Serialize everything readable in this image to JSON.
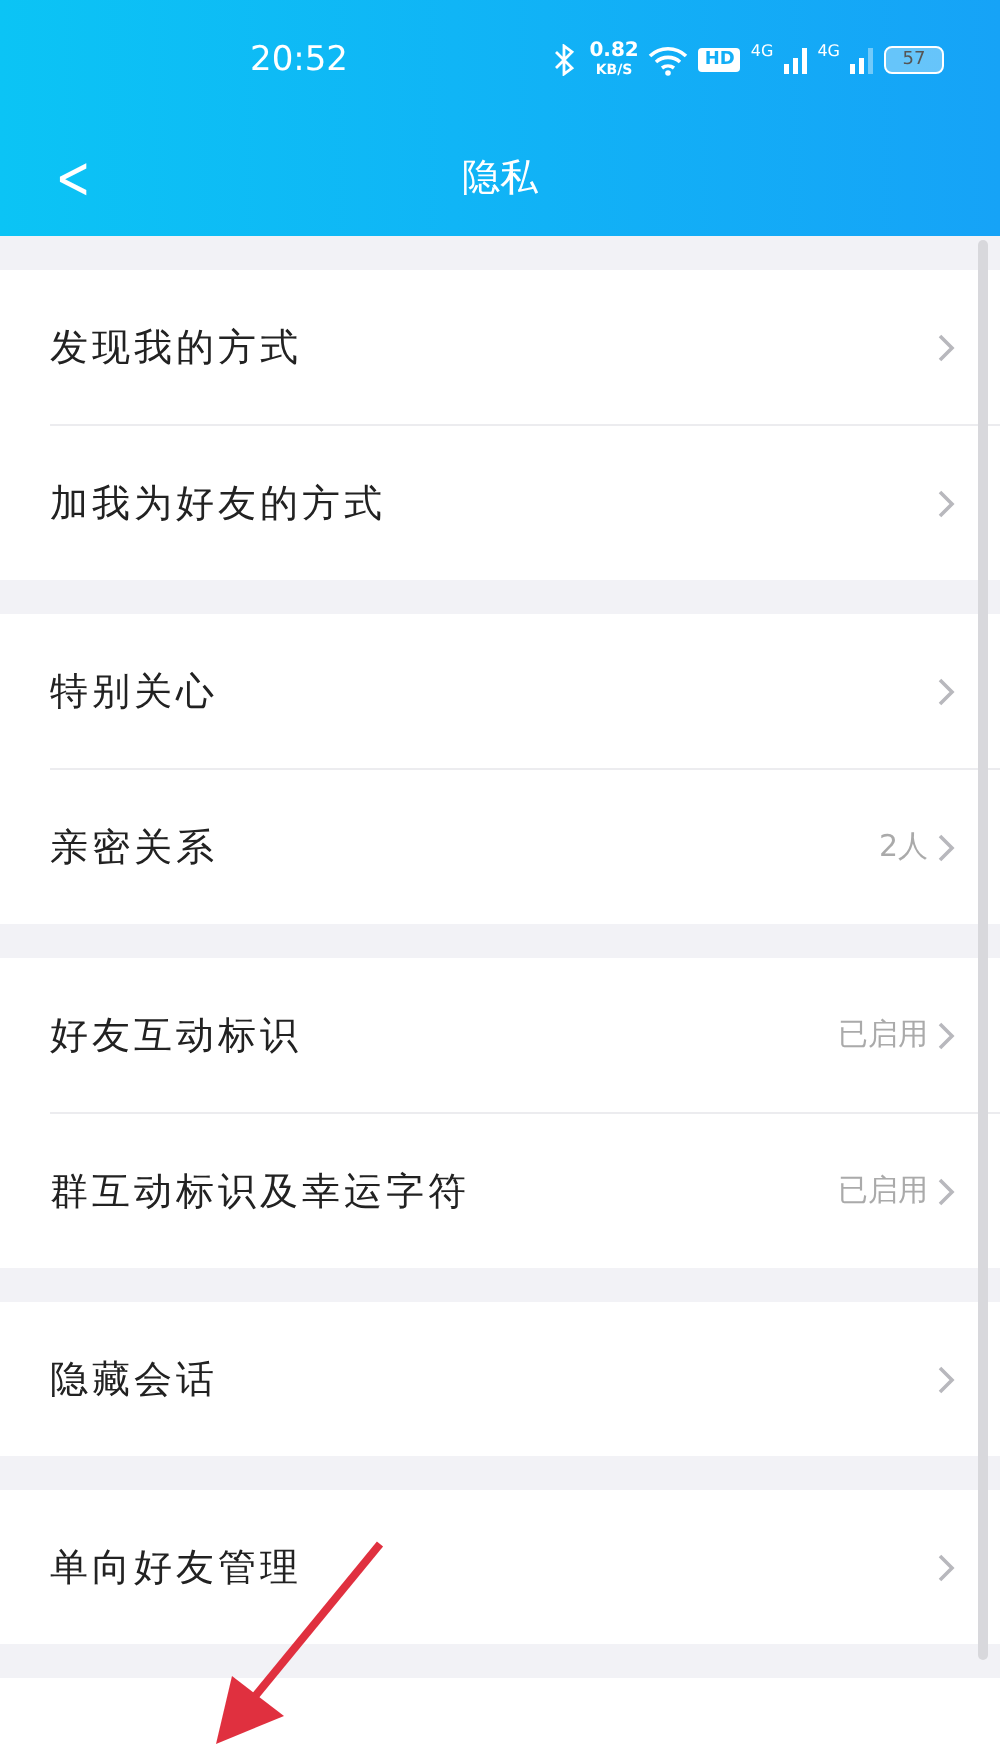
{
  "status_bar": {
    "time": "20:52",
    "speed": "0.82",
    "speed_unit": "KB/S",
    "hd": "HD",
    "sim1": "4G",
    "sim2": "4G",
    "battery": "57"
  },
  "header": {
    "back": "<",
    "title": "隐私"
  },
  "groups": [
    {
      "rows": [
        {
          "label": "发现我的方式"
        },
        {
          "label": "加我为好友的方式"
        }
      ]
    },
    {
      "rows": [
        {
          "label": "特别关心"
        },
        {
          "label": "亲密关系",
          "value": "2人"
        }
      ]
    },
    {
      "rows": [
        {
          "label": "好友互动标识",
          "value": "已启用"
        },
        {
          "label": "群互动标识及幸运字符",
          "value": "已启用"
        }
      ]
    },
    {
      "rows": [
        {
          "label": "隐藏会话"
        }
      ]
    },
    {
      "rows": [
        {
          "label": "单向好友管理"
        }
      ]
    },
    {
      "rows": [
        {}
      ]
    }
  ]
}
